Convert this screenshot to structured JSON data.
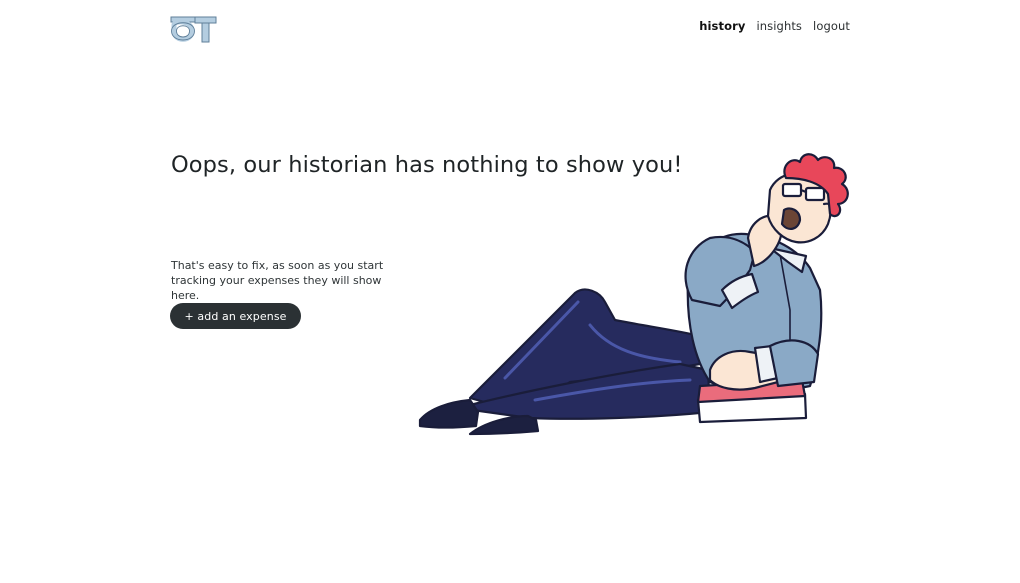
{
  "header": {
    "nav": [
      {
        "label": "history",
        "active": true
      },
      {
        "label": "insights",
        "active": false
      },
      {
        "label": "logout",
        "active": false
      }
    ]
  },
  "empty_state": {
    "headline": "Oops, our historian has nothing to show you!",
    "description": "That's easy to fix, as soon as you start tracking your expenses they will show here.",
    "cta_label": "+ add an expense"
  },
  "colors": {
    "logo": "#b4cde0",
    "button_bg": "#2b3134",
    "shirt": "#8aa9c6",
    "pants": "#262b5e",
    "hair": "#e8475a",
    "book": "#ea6c7c"
  },
  "icons": {
    "logo": "ot-logo",
    "illustration": "reclining-historian-illustration"
  }
}
